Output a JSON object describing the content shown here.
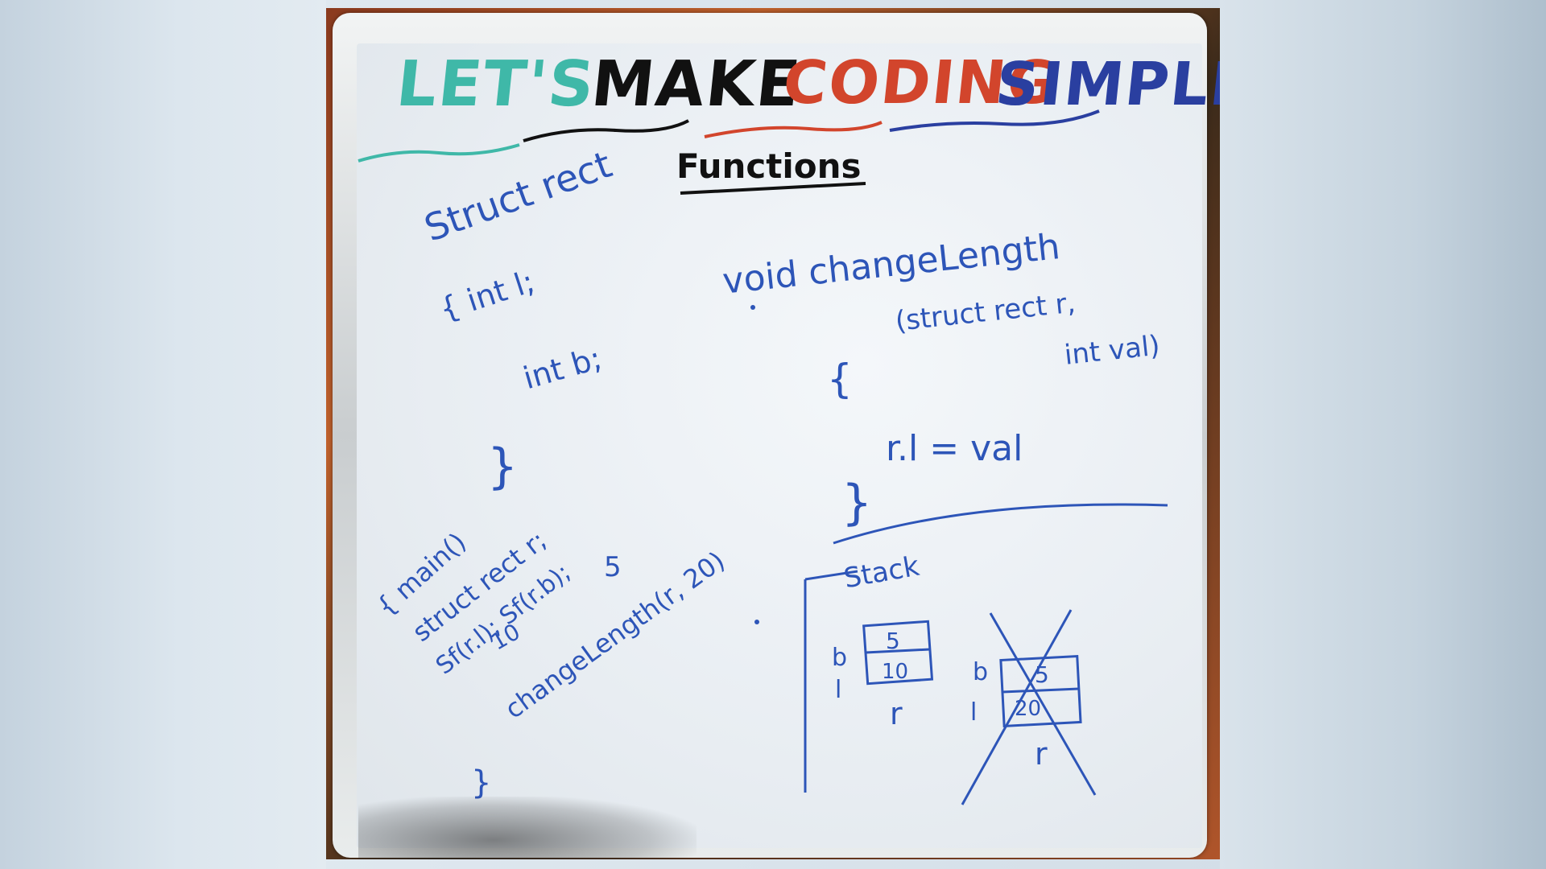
{
  "title": {
    "words": [
      "LET'S",
      "MAKE",
      "CODING",
      "SIMPLE"
    ],
    "colors": [
      "#3fb8a8",
      "#111111",
      "#d2452c",
      "#2a3fa0"
    ]
  },
  "heading": "Functions",
  "code": {
    "struct_line": "Struct rect",
    "field_l": "{ int l;",
    "field_b": "int b;",
    "close_brace": "}",
    "func_sig": "void changeLength",
    "func_params": "(struct rect r,",
    "func_params2": "int val)",
    "func_open": "{",
    "func_body": "r.l = val",
    "func_close": "}",
    "main_line": "{ main()",
    "main_decl": "struct rect r;",
    "main_scan": "Sf(r.l); Sf(r.b);",
    "main_val_l": "10",
    "main_val_b": "5",
    "main_call": "changeLength(r, 20)",
    "main_close": "}"
  },
  "stack": {
    "label": "Stack",
    "frame1": {
      "b": "5",
      "l": "10",
      "name": "r",
      "b_label": "b",
      "l_label": "l"
    },
    "frame2": {
      "b": "5",
      "l": "20",
      "name": "r",
      "b_label": "b",
      "l_label": "l"
    }
  },
  "ink_colors": {
    "marker_blue": "#2d55b8",
    "marker_black": "#111111"
  }
}
